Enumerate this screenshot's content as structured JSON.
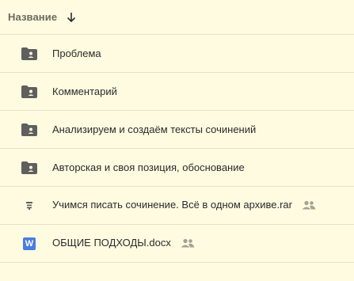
{
  "header": {
    "title": "Название",
    "sort_icon": "arrow-down-icon"
  },
  "colors": {
    "background": "#fefbe0",
    "divider": "#e6e2c8",
    "folder": "#5f5f5f",
    "word_blue": "#4a7de0"
  },
  "files": [
    {
      "name": "Проблема",
      "icon": "shared-folder-icon"
    },
    {
      "name": "Комментарий",
      "icon": "shared-folder-icon"
    },
    {
      "name": "Анализируем и создаём тексты сочинений",
      "icon": "shared-folder-icon"
    },
    {
      "name": "Авторская и своя позиция, обоснование",
      "icon": "shared-folder-icon"
    },
    {
      "name": "Учимся писать сочинение. Всё в одном архиве.rar",
      "icon": "archive-icon",
      "shared": true
    },
    {
      "name": "ОБЩИЕ ПОДХОДЫ.docx",
      "icon": "word-doc-icon",
      "badge": "W",
      "shared": true
    }
  ]
}
